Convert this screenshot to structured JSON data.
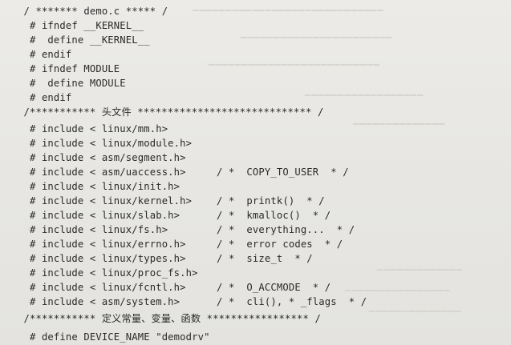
{
  "code": {
    "lines": [
      " / ******* demo.c ***** /",
      "  # ifndef __KERNEL__",
      "  #  define __KERNEL__",
      "  # endif",
      "  # ifndef MODULE",
      "  #  define MODULE",
      "  # endif",
      " /*********** 头文件 ***************************** /",
      "  # include < linux/mm.h>",
      "  # include < linux/module.h>",
      "  # include < asm/segment.h>",
      "  # include < asm/uaccess.h>",
      "  # include < linux/init.h>",
      "  # include < linux/kernel.h>",
      "  # include < linux/slab.h>",
      "  # include < linux/fs.h>",
      "  # include < linux/errno.h>",
      "  # include < linux/types.h>",
      "  # include < linux/proc_fs.h>",
      "  # include < linux/fcntl.h>",
      "  # include < asm/system.h>",
      " /*********** 定义常量、变量、函数 ***************** /",
      "  # define DEVICE_NAME \"demodrv\""
    ],
    "comments": {
      "uaccess": "/ *  COPY_TO_USER  * /",
      "kernel": "/ *  printk()  * /",
      "slab": "/ *  kmalloc()  * /",
      "fs": "/ *  everything...  * /",
      "errno": "/ *  error codes  * /",
      "types": "/ *  size_t  * /",
      "fcntl": "/ *  O_ACCMODE  * /",
      "system": "/ *  cli(), * _flags  * /"
    }
  }
}
